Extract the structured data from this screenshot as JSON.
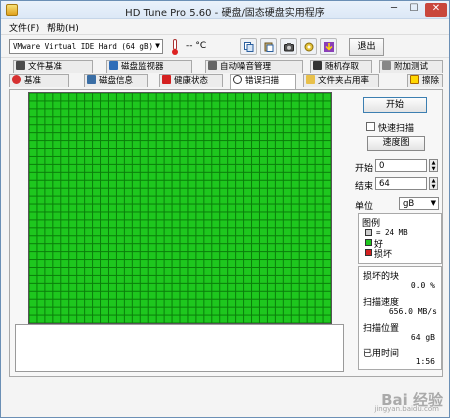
{
  "window": {
    "title": "HD Tune Pro 5.60 - 硬盘/固态硬盘实用程序"
  },
  "menu": {
    "file": "文件(F)",
    "help": "帮助(H)"
  },
  "toolbar": {
    "drive": "VMware Virtual IDE Hard (64 gB)",
    "temperature": "-- °C",
    "exit_label": "退出",
    "buttons": [
      "copy-icon",
      "paste-icon",
      "camera-icon",
      "options-icon",
      "download-icon"
    ]
  },
  "tabs": {
    "top": [
      "文件基准",
      "磁盘监视器",
      "自动噪音管理",
      "随机存取",
      "附加测试"
    ],
    "bottom": [
      "基准",
      "磁盘信息",
      "健康状态",
      "错误扫描",
      "文件夹占用率",
      "擦除"
    ],
    "active": "错误扫描"
  },
  "scan": {
    "columns": 38,
    "rows": 29,
    "block_color": "#1ec71e",
    "grid_color": "#0a7d0a",
    "damaged_blocks": 0
  },
  "controls": {
    "start_label": "开始",
    "quick_scan_label": "快速扫描",
    "quick_scan_checked": false,
    "speed_map_label": "速度图",
    "start_pos_label": "开始",
    "start_pos_value": "0",
    "end_pos_label": "结束",
    "end_pos_value": "64",
    "unit_label": "单位",
    "unit_value": "gB"
  },
  "legend": {
    "title": "图例",
    "block_size": "= 24 MB",
    "good_label": "好",
    "bad_label": "损坏",
    "good_color": "#1ec71e",
    "bad_color": "#d42020"
  },
  "stats": {
    "damaged_label": "损坏的块",
    "damaged_value": "0.0 %",
    "speed_label": "扫描速度",
    "speed_value": "656.0 MB/s",
    "position_label": "扫描位置",
    "position_value": "64 gB",
    "elapsed_label": "已用时间",
    "elapsed_value": "1:56"
  },
  "watermark": {
    "text": "Bai 经验",
    "sub": "jingyan.baidu.com"
  }
}
